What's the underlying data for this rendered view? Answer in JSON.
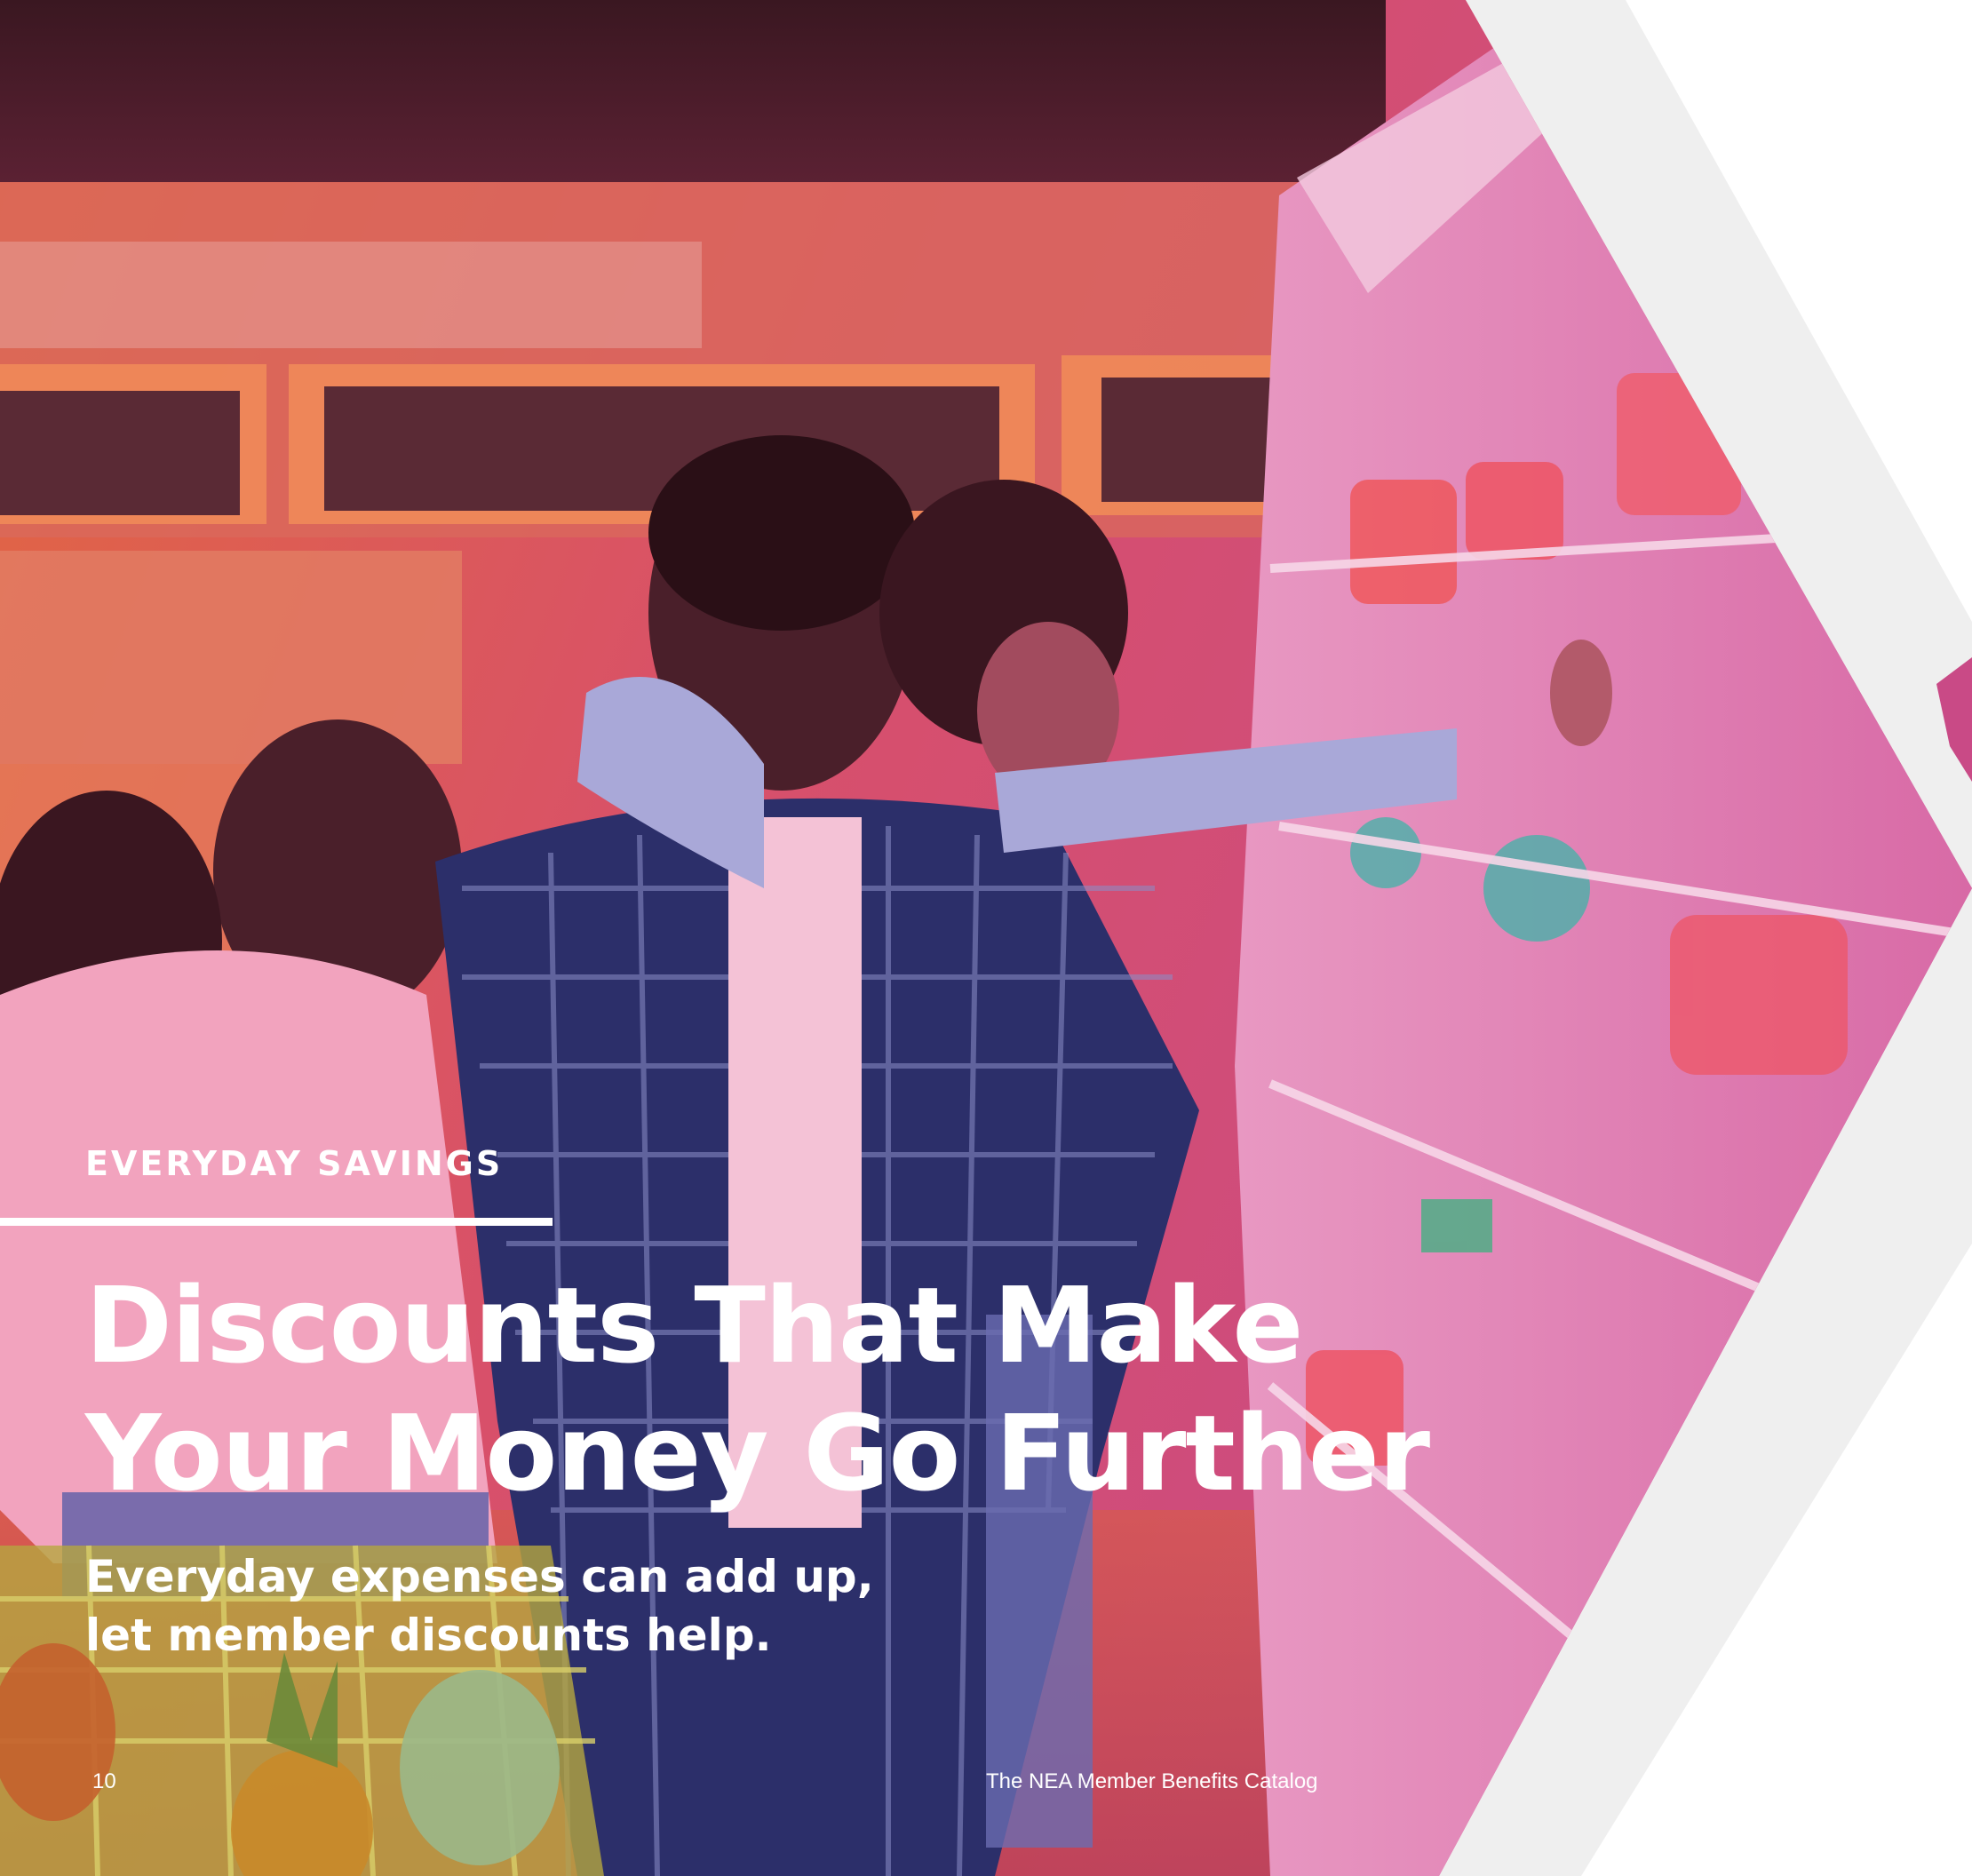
{
  "section": {
    "eyebrow": "EVERYDAY SAVINGS"
  },
  "headline": {
    "line1": "Discounts That Make",
    "line2": "Your Money Go Further"
  },
  "subhead": {
    "line1": "Everyday expenses can add up,",
    "line2": "let member discounts help."
  },
  "footer": {
    "page_number": "10",
    "publication": "The NEA Member Benefits Catalog"
  },
  "colors": {
    "overlay_magenta": "#d0457f",
    "overlay_orange": "#e86a3d",
    "frame_gray": "#efefef",
    "text": "#ffffff"
  }
}
